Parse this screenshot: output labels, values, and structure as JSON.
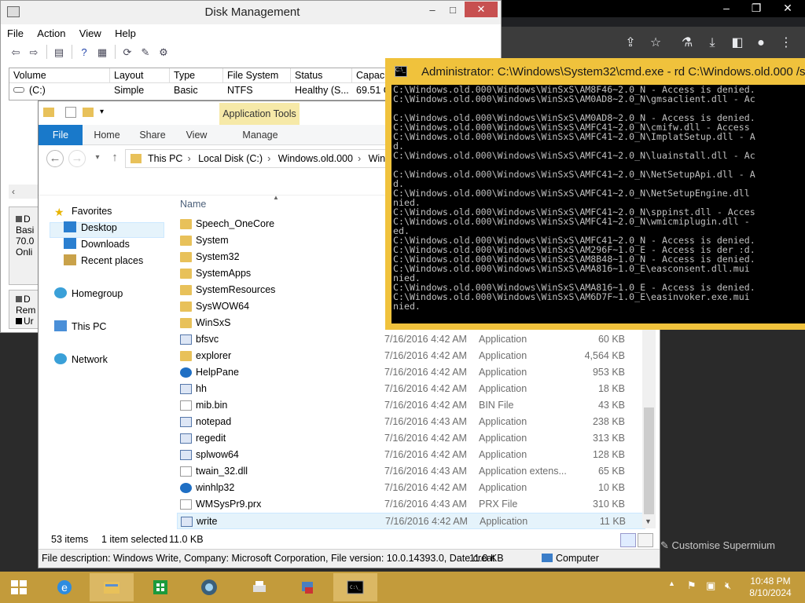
{
  "browser": {
    "customise_label": "Customise Supermium"
  },
  "disk_management": {
    "title": "Disk Management",
    "menu": [
      "File",
      "Action",
      "View",
      "Help"
    ],
    "columns": [
      "Volume",
      "Layout",
      "Type",
      "File System",
      "Status",
      "Capacit"
    ],
    "rows": [
      {
        "volume": "(C:)",
        "layout": "Simple",
        "type": "Basic",
        "file_system": "NTFS",
        "status": "Healthy (S...",
        "capacity": "69.51 G"
      }
    ],
    "disk0": {
      "label": "D",
      "type": "Basi",
      "size": "70.0",
      "state": "Onli"
    },
    "disk1": {
      "label": "D",
      "type": "Rem",
      "state": "Ur"
    }
  },
  "explorer": {
    "context_tab": "Application Tools",
    "tabs": [
      "File",
      "Home",
      "Share",
      "View",
      "Manage"
    ],
    "breadcrumb": [
      "This PC",
      "Local Disk (C:)",
      "Windows.old.000",
      "Win"
    ],
    "nav": {
      "favorites": "Favorites",
      "desktop": "Desktop",
      "downloads": "Downloads",
      "recent": "Recent places",
      "homegroup": "Homegroup",
      "thispc": "This PC",
      "network": "Network"
    },
    "column_name": "Name",
    "files": [
      {
        "name": "Speech_OneCore",
        "kind": "folder",
        "date": "",
        "type": "",
        "size": ""
      },
      {
        "name": "System",
        "kind": "folder",
        "date": "",
        "type": "",
        "size": ""
      },
      {
        "name": "System32",
        "kind": "folder",
        "date": "",
        "type": "",
        "size": ""
      },
      {
        "name": "SystemApps",
        "kind": "folder",
        "date": "",
        "type": "",
        "size": ""
      },
      {
        "name": "SystemResources",
        "kind": "folder",
        "date": "",
        "type": "",
        "size": ""
      },
      {
        "name": "SysWOW64",
        "kind": "folder",
        "date": "",
        "type": "",
        "size": ""
      },
      {
        "name": "WinSxS",
        "kind": "folder",
        "date": "",
        "type": "",
        "size": ""
      },
      {
        "name": "bfsvc",
        "kind": "app",
        "date": "7/16/2016 4:42 AM",
        "type": "Application",
        "size": "60 KB"
      },
      {
        "name": "explorer",
        "kind": "folder",
        "date": "7/16/2016 4:42 AM",
        "type": "Application",
        "size": "4,564 KB"
      },
      {
        "name": "HelpPane",
        "kind": "help",
        "date": "7/16/2016 4:42 AM",
        "type": "Application",
        "size": "953 KB"
      },
      {
        "name": "hh",
        "kind": "app",
        "date": "7/16/2016 4:42 AM",
        "type": "Application",
        "size": "18 KB"
      },
      {
        "name": "mib.bin",
        "kind": "file",
        "date": "7/16/2016 4:42 AM",
        "type": "BIN File",
        "size": "43 KB"
      },
      {
        "name": "notepad",
        "kind": "app",
        "date": "7/16/2016 4:43 AM",
        "type": "Application",
        "size": "238 KB"
      },
      {
        "name": "regedit",
        "kind": "app",
        "date": "7/16/2016 4:42 AM",
        "type": "Application",
        "size": "313 KB"
      },
      {
        "name": "splwow64",
        "kind": "app",
        "date": "7/16/2016 4:42 AM",
        "type": "Application",
        "size": "128 KB"
      },
      {
        "name": "twain_32.dll",
        "kind": "file",
        "date": "7/16/2016 4:43 AM",
        "type": "Application extens...",
        "size": "65 KB"
      },
      {
        "name": "winhlp32",
        "kind": "help",
        "date": "7/16/2016 4:42 AM",
        "type": "Application",
        "size": "10 KB"
      },
      {
        "name": "WMSysPr9.prx",
        "kind": "file",
        "date": "7/16/2016 4:43 AM",
        "type": "PRX File",
        "size": "310 KB"
      },
      {
        "name": "write",
        "kind": "app",
        "date": "7/16/2016 4:42 AM",
        "type": "Application",
        "size": "11 KB"
      }
    ],
    "status": {
      "items": "53 items",
      "selected": "1 item selected",
      "selected_size": "11.0 KB"
    },
    "description": "File description: Windows Write, Company: Microsoft Corporation, File version: 10.0.14393.0, Date creat",
    "description_size": "11.0 KB",
    "description_location": "Computer"
  },
  "cmd": {
    "title": "Administrator: C:\\Windows\\System32\\cmd.exe - rd  C:\\Windows.old.000 /s",
    "lines": [
      "C:\\Windows.old.000\\Windows\\WinSxS\\AM8F46~2.0_N - Access is denied.",
      "C:\\Windows.old.000\\Windows\\WinSxS\\AM0AD8~2.0_N\\gmsaclient.dll - Ac",
      "",
      "C:\\Windows.old.000\\Windows\\WinSxS\\AM0AD8~2.0_N - Access is denied.",
      "C:\\Windows.old.000\\Windows\\WinSxS\\AMFC41~2.0_N\\cmifw.dll - Access",
      "C:\\Windows.old.000\\Windows\\WinSxS\\AMFC41~2.0_N\\ImplatSetup.dll - A",
      "d.",
      "C:\\Windows.old.000\\Windows\\WinSxS\\AMFC41~2.0_N\\luainstall.dll - Ac",
      "",
      "C:\\Windows.old.000\\Windows\\WinSxS\\AMFC41~2.0_N\\NetSetupApi.dll - A",
      "d.",
      "C:\\Windows.old.000\\Windows\\WinSxS\\AMFC41~2.0_N\\NetSetupEngine.dll",
      "nied.",
      "C:\\Windows.old.000\\Windows\\WinSxS\\AMFC41~2.0_N\\sppinst.dll - Acces",
      "C:\\Windows.old.000\\Windows\\WinSxS\\AMFC41~2.0_N\\wmicmiplugin.dll -",
      "ed.",
      "C:\\Windows.old.000\\Windows\\WinSxS\\AMFC41~2.0_N - Access is denied.",
      "C:\\Windows.old.000\\Windows\\WinSxS\\AM296F~1.0_E - Access is der :d.",
      "C:\\Windows.old.000\\Windows\\WinSxS\\AM8B48~1.0_N - Access is denied.",
      "C:\\Windows.old.000\\Windows\\WinSxS\\AMA816~1.0_E\\easconsent.dll.mui",
      "nied.",
      "C:\\Windows.old.000\\Windows\\WinSxS\\AMA816~1.0_E - Access is denied.",
      "C:\\Windows.old.000\\Windows\\WinSxS\\AM6D7F~1.0_E\\easinvoker.exe.mui",
      "nied."
    ]
  },
  "taskbar": {
    "time": "10:48 PM",
    "date": "8/10/2024"
  },
  "colors": {
    "taskbar": "#c39b3b",
    "cmd_frame": "#f0c23c",
    "explorer_file_tab": "#1979ca",
    "app_tools": "#f6e9a8"
  }
}
